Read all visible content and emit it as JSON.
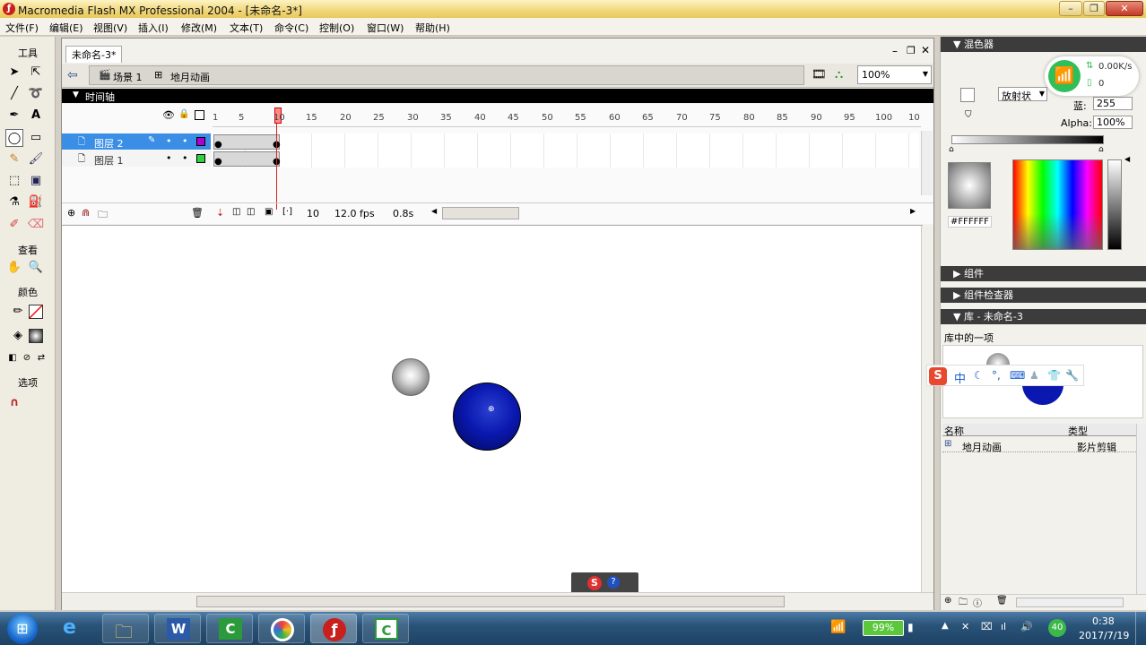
{
  "window": {
    "title": "Macromedia Flash MX Professional 2004 - [未命名-3*]"
  },
  "menu": [
    "文件(F)",
    "编辑(E)",
    "视图(V)",
    "插入(I)",
    "修改(M)",
    "文本(T)",
    "命令(C)",
    "控制(O)",
    "窗口(W)",
    "帮助(H)"
  ],
  "tools": {
    "title": "工具",
    "view": "查看",
    "colors": "颜色",
    "options": "选项"
  },
  "document": {
    "tab": "未命名-3*",
    "scene": "场景 1",
    "symbol": "地月动画",
    "zoom": "100%"
  },
  "timeline": {
    "header": "时间轴",
    "ruler": [
      "1",
      "5",
      "10",
      "15",
      "20",
      "25",
      "30",
      "35",
      "40",
      "45",
      "50",
      "55",
      "60",
      "65",
      "70",
      "75",
      "80",
      "85",
      "90",
      "95",
      "100",
      "10"
    ],
    "layers": [
      {
        "name": "图层 2",
        "selected": true,
        "color": "#b000d0"
      },
      {
        "name": "图层 1",
        "selected": false,
        "color": "#30d040"
      }
    ],
    "current_frame": "10",
    "fps": "12.0 fps",
    "time": "0.8s"
  },
  "mixer": {
    "header": "混色器",
    "fill_type": "放射状",
    "blue_label": "蓝:",
    "blue_value": "255",
    "alpha_label": "Alpha:",
    "alpha_value": "100%",
    "hex": "#FFFFFF"
  },
  "panels": {
    "components": "组件",
    "inspector": "组件检查器",
    "library": "库 - 未命名-3",
    "library_count": "库中的一项",
    "col_name": "名称",
    "col_type": "类型",
    "item_name": "地月动画",
    "item_type": "影片剪辑"
  },
  "network": {
    "speed": "0.00K/s",
    "count": "0"
  },
  "ime": {
    "mode": "中"
  },
  "tray": {
    "battery": "99%",
    "badge": "40",
    "time": "0:38",
    "date": "2017/7/19"
  }
}
